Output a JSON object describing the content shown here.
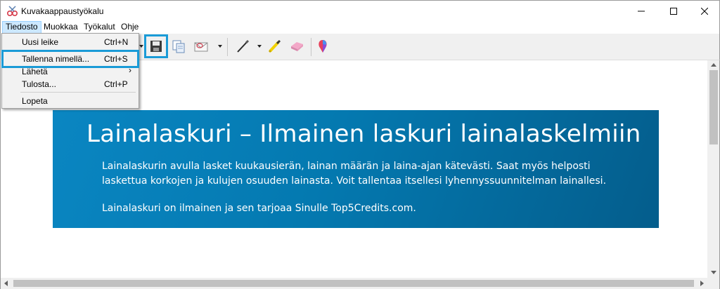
{
  "window": {
    "title": "Kuvakaappaustyökalu"
  },
  "menubar": {
    "items": [
      {
        "label": "Tiedosto"
      },
      {
        "label": "Muokkaa"
      },
      {
        "label": "Työkalut"
      },
      {
        "label": "Ohje"
      }
    ]
  },
  "file_menu": {
    "items": [
      {
        "label": "Uusi leike",
        "shortcut": "Ctrl+N"
      },
      {
        "label": "Tallenna nimellä...",
        "shortcut": "Ctrl+S",
        "selected": true
      },
      {
        "label": "Lähetä",
        "submenu": "›"
      },
      {
        "label": "Tulosta...",
        "shortcut": "Ctrl+P"
      },
      {
        "label": "Lopeta"
      }
    ]
  },
  "toolbar": {
    "buttons": [
      "save-icon",
      "copy-icon",
      "send-email-icon",
      "pen-icon",
      "highlighter-icon",
      "eraser-icon",
      "paint3d-icon"
    ]
  },
  "banner": {
    "title": "Lainalaskuri – Ilmainen laskuri lainalaskelmiin",
    "paragraph1": "Lainalaskurin avulla lasket kuukausierän, lainan määrän ja laina-ajan kätevästi. Saat myös helposti laskettua korkojen ja kulujen osuuden lainasta. Voit tallentaa itsellesi lyhennyssuunnitelman lainallesi.",
    "paragraph2": "Lainalaskuri on ilmainen ja sen tarjoaa Sinulle Top5Credits.com."
  },
  "colors": {
    "highlight": "#1a9bd7",
    "banner_start": "#0a86c2",
    "banner_end": "#045d8c",
    "menu_active": "#cce8ff"
  }
}
